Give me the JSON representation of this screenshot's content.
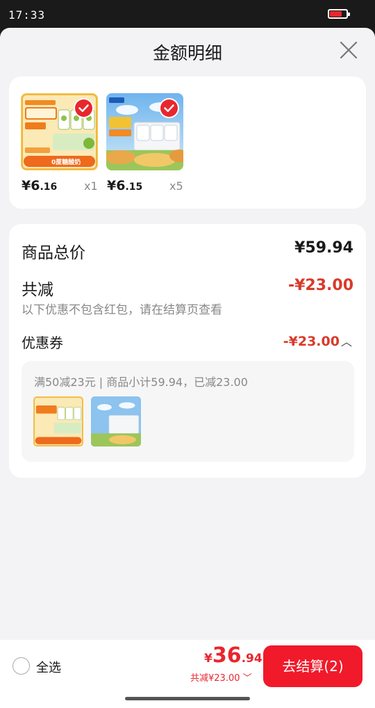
{
  "status_bar": {
    "time": "17:33",
    "battery_level": 0.75,
    "battery_color": "#e8262d"
  },
  "header": {
    "title": "金额明细"
  },
  "products": [
    {
      "thumb_text": "0蔗糖酸奶",
      "currency": "¥",
      "price_int": "6",
      "price_dec": ".16",
      "qty": "x1"
    },
    {
      "thumb_text": "",
      "currency": "¥",
      "price_int": "6",
      "price_dec": ".15",
      "qty": "x5"
    }
  ],
  "summary": {
    "total_label": "商品总价",
    "total_value": "¥59.94",
    "reduce_label": "共减",
    "reduce_value": "-¥23.00",
    "note": "以下优惠不包含红包，请在结算页查看",
    "coupon_label": "优惠券",
    "coupon_value": "-¥23.00",
    "coupon_detail": "满50减23元 | 商品小计59.94，已减23.00"
  },
  "footer": {
    "select_all": "全选",
    "pay_currency": "¥",
    "pay_int": "36",
    "pay_dec": ".94",
    "pay_reduce": "共减¥23.00",
    "checkout": "去结算(2)"
  },
  "colors": {
    "accent": "#e8262d",
    "discount": "#d93a2b",
    "checkout_bg": "#f01a2a"
  }
}
